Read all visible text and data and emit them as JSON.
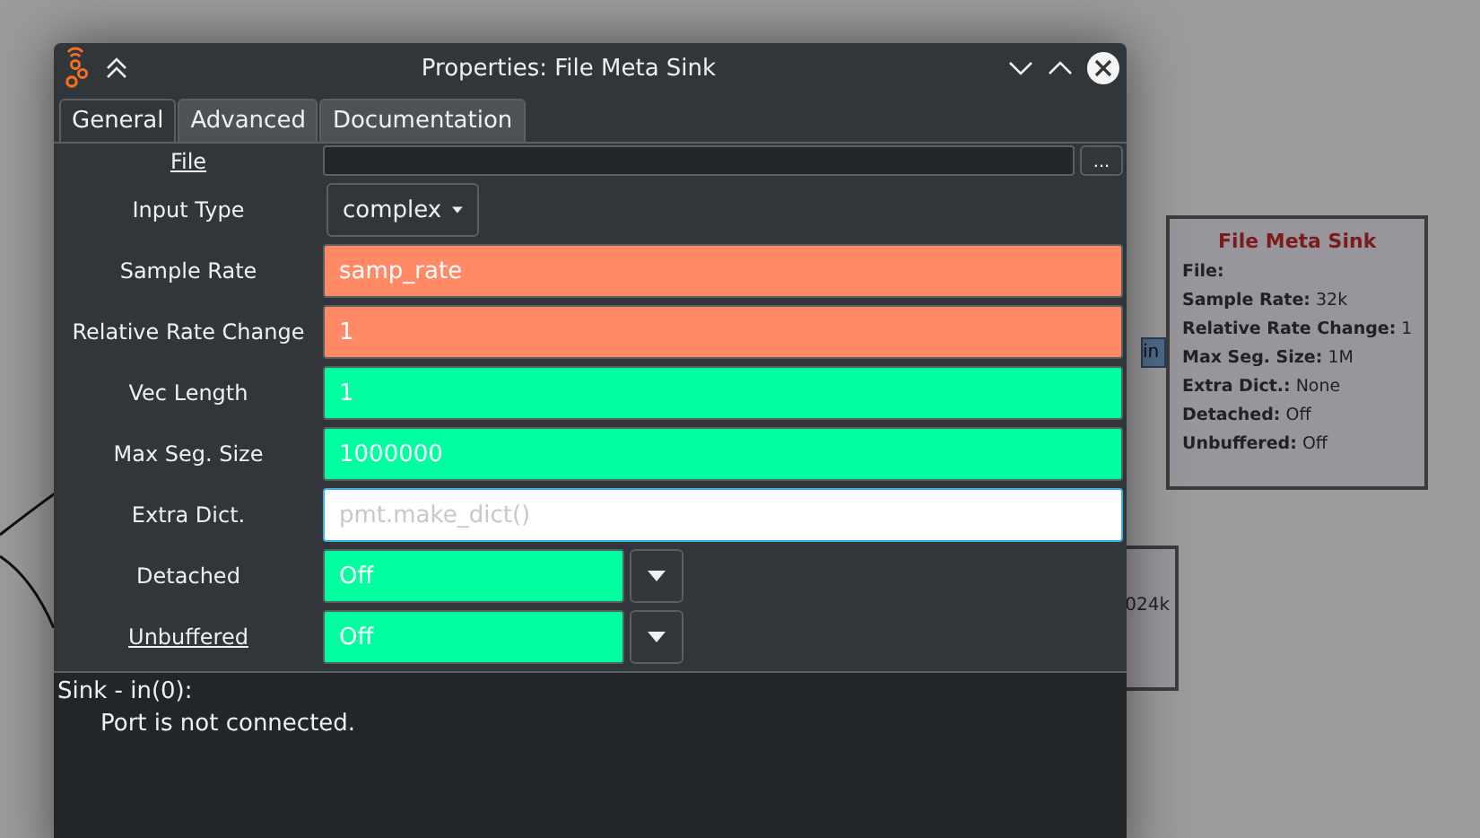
{
  "canvas": {
    "blocks": [
      {
        "title": "File Meta Sink",
        "lines": [
          {
            "key": "File:"
          },
          {
            "key": "Sample Rate:",
            "value": "32k"
          },
          {
            "key": "Relative Rate Change:",
            "value": "1"
          },
          {
            "key": "Max Seg. Size:",
            "value": "1M"
          },
          {
            "key": "Extra Dict.:",
            "value": "None"
          },
          {
            "key": "Detached:",
            "value": "Off"
          },
          {
            "key": "Unbuffered:",
            "value": "Off"
          }
        ]
      }
    ],
    "port": "in",
    "partial_block": {
      "text": "024k"
    }
  },
  "window": {
    "title": "Properties: File Meta Sink"
  },
  "tabs": [
    {
      "label": "General",
      "selected": true
    },
    {
      "label": "Advanced",
      "selected": false
    },
    {
      "label": "Documentation",
      "selected": false
    }
  ],
  "params": [
    {
      "kind": "file",
      "label": "File",
      "underlined": true,
      "button": "...",
      "color": "#232629",
      "focused": false
    },
    {
      "kind": "combo",
      "label": "Input Type",
      "underlined": false,
      "value": "complex"
    },
    {
      "kind": "text",
      "label": "Sample Rate",
      "underlined": false,
      "value": "samp_rate",
      "color": "#ff8a65",
      "focused": false
    },
    {
      "kind": "text",
      "label": "Relative Rate Change",
      "underlined": false,
      "value": "1",
      "color": "#ff8a65",
      "focused": false
    },
    {
      "kind": "text",
      "label": "Vec Length",
      "underlined": false,
      "value": "1",
      "color": "#00ff9f",
      "focused": false
    },
    {
      "kind": "text",
      "label": "Max Seg. Size",
      "underlined": false,
      "value": "1000000",
      "color": "#00ff9f",
      "focused": false
    },
    {
      "kind": "text",
      "label": "Extra Dict.",
      "underlined": false,
      "placeholder": "pmt.make_dict()",
      "color": "#ffffff",
      "focused": true
    },
    {
      "kind": "enum",
      "label": "Detached",
      "underlined": false,
      "value": "Off",
      "color": "#00ff9f",
      "focused": false
    },
    {
      "kind": "enum",
      "label": "Unbuffered",
      "underlined": true,
      "value": "Off",
      "color": "#00ff9f",
      "focused": false
    }
  ],
  "messages": {
    "heading": "Sink - in(0):",
    "text": "Port is not connected."
  }
}
